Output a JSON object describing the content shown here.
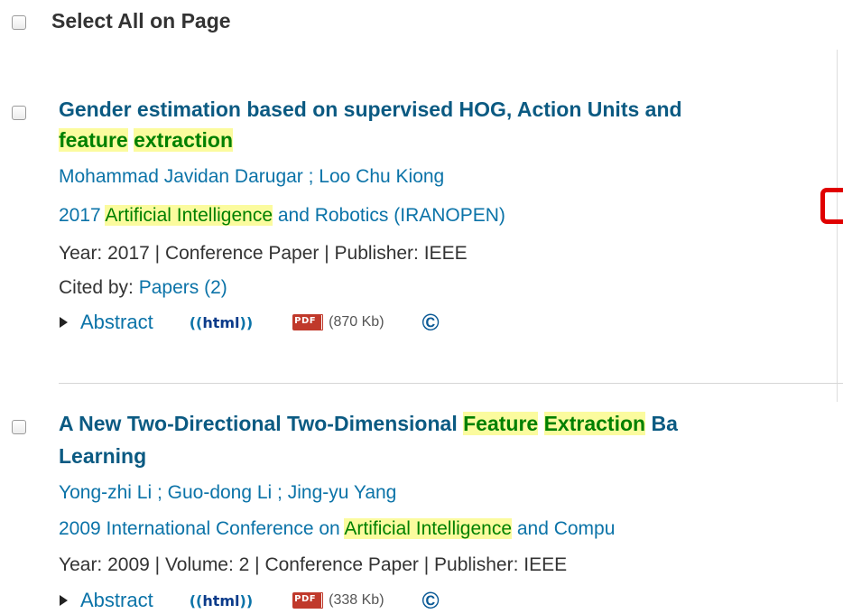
{
  "select_all": {
    "label": "Select All on Page"
  },
  "results": [
    {
      "title_parts": [
        "Gender estimation based on supervised HOG, Action Units and",
        "feature",
        " ",
        "extraction"
      ],
      "authors": "Mohammad Javidan Darugar ; Loo Chu Kiong",
      "publication": {
        "before": "2017 ",
        "highlight": "Artificial Intelligence",
        "after": " and Robotics (IRANOPEN)"
      },
      "meta": "Year: 2017 | Conference Paper | Publisher: IEEE",
      "cited": {
        "label": "Cited by:",
        "link": "Papers (2)"
      },
      "abstract_label": "Abstract",
      "html_label": "html",
      "pdf_label": "PDF",
      "pdf_size": "(870 Kb)",
      "copyright_icon": "©"
    },
    {
      "title_parts": [
        "A New Two-Directional Two-Dimensional ",
        "Feature",
        " ",
        "Extraction",
        " Ba",
        "Learning"
      ],
      "authors": "Yong-zhi Li ; Guo-dong Li ; Jing-yu Yang",
      "publication": {
        "before": "2009 International Conference on ",
        "highlight": "Artificial Intelligence",
        "after": " and Compu"
      },
      "meta": "Year: 2009 | Volume: 2 | Conference Paper | Publisher: IEEE",
      "abstract_label": "Abstract",
      "html_label": "html",
      "pdf_label": "PDF",
      "pdf_size": "(338 Kb)",
      "copyright_icon": "©"
    }
  ],
  "colors": {
    "title": "#0b5a82",
    "link": "#0b73a8",
    "highlight_bg": "#fbfb9e",
    "highlight_text": "#008000",
    "annotation": "#e00000"
  }
}
